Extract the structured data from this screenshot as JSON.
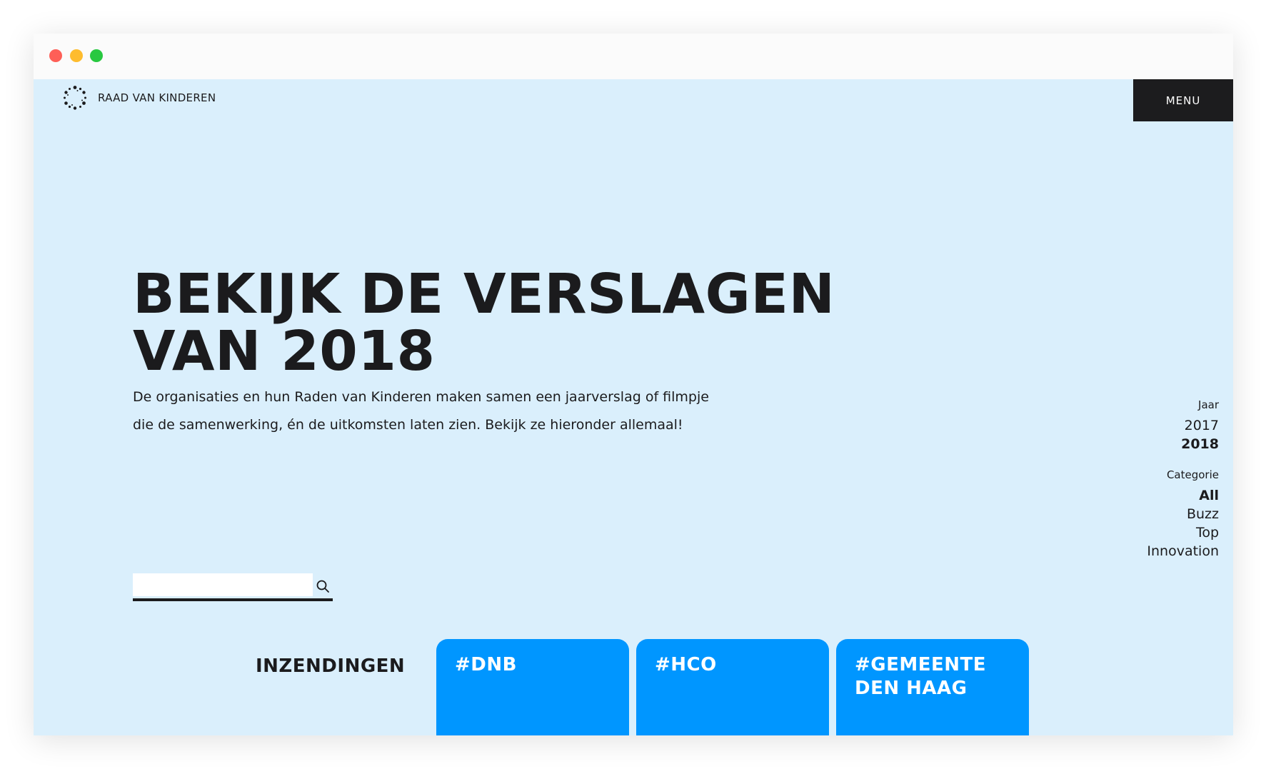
{
  "window": {
    "controls": [
      "close",
      "minimize",
      "maximize"
    ]
  },
  "header": {
    "logo_icon": "dotted-ring-logo-icon",
    "logo_text": "RAAD VAN KINDEREN",
    "menu_label": "MENU"
  },
  "hero": {
    "title_line1": "BEKIJK DE VERSLAGEN",
    "title_line2": "VAN 2018",
    "intro": "De organisaties en hun Raden van Kinderen maken samen een jaarverslag of filmpje die de samenwerking, én de uitkomsten laten zien. Bekijk ze hieronder allemaal!"
  },
  "filters": {
    "year_heading": "Jaar",
    "years": [
      {
        "label": "2017",
        "active": false
      },
      {
        "label": "2018",
        "active": true
      }
    ],
    "category_heading": "Categorie",
    "categories": [
      {
        "label": "All",
        "active": true
      },
      {
        "label": "Buzz",
        "active": false
      },
      {
        "label": "Top",
        "active": false
      },
      {
        "label": "Innovation",
        "active": false
      }
    ]
  },
  "search": {
    "placeholder": "",
    "value": "",
    "icon": "search-icon"
  },
  "submissions": {
    "label": "INZENDINGEN",
    "cards": [
      {
        "title": "#DNB"
      },
      {
        "title": "#HCO"
      },
      {
        "title": "#GEMEENTE DEN HAAG"
      }
    ]
  },
  "colors": {
    "background": "#daeffc",
    "dark": "#1c1c1e",
    "card_blue": "#0096ff",
    "close_dot": "#fe5f57",
    "minimize_dot": "#febc2e",
    "maximize_dot": "#28c840"
  }
}
